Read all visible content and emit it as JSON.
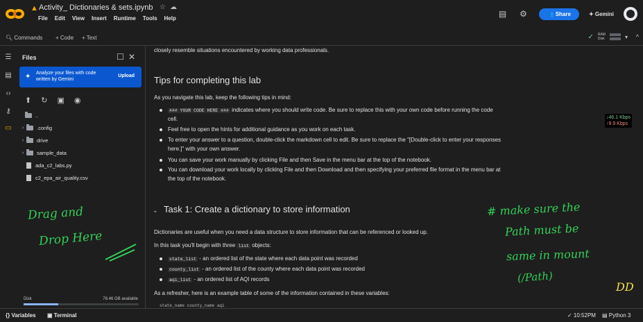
{
  "window": {
    "notebook_title": "Activity_ Dictionaries & sets.ipynb",
    "menu": [
      "File",
      "Edit",
      "View",
      "Insert",
      "Runtime",
      "Tools",
      "Help"
    ],
    "share_label": "Share",
    "gemini_label": "Gemini"
  },
  "toolbar": {
    "commands_label": "Commands",
    "code_label": "+ Code",
    "text_label": "+ Text",
    "ram_label": "RAM",
    "disk_label": "Disk"
  },
  "files_panel": {
    "title": "Files",
    "gemini_card_text": "Analyze your files with code written by Gemini",
    "upload_label": "Upload",
    "tree": [
      {
        "name": "..",
        "kind": "folder",
        "expandable": false
      },
      {
        "name": ".config",
        "kind": "folder",
        "expandable": true
      },
      {
        "name": "drive",
        "kind": "folder",
        "expandable": true
      },
      {
        "name": "sample_data",
        "kind": "folder",
        "expandable": true
      },
      {
        "name": "ada_c2_labs.py",
        "kind": "file",
        "expandable": false
      },
      {
        "name": "c2_epa_air_quality.csv",
        "kind": "file",
        "expandable": false
      }
    ],
    "disk_label": "Disk",
    "disk_available": "78.46 GB available",
    "disk_used_fraction": 0.3
  },
  "content": {
    "intro_line": "closely resemble situations encountered by working data professionals.",
    "tips_heading": "Tips for completing this lab",
    "tips_intro": "As you navigate this lab, keep the following tips in mind:",
    "tip1_code": "### YOUR CODE HERE ###",
    "tip1_text": "indicates where you should write code. Be sure to replace this with your own code before running the code",
    "tip1_text_cont": "cell.",
    "tip2": "Feel free to open the hints for additional guidance as you work on each task.",
    "tip3": "To enter your answer to a question, double-click the markdown cell to edit. Be sure to replace the \"[Double-click to enter your responses",
    "tip3_cont": "here.]\" with your own answer.",
    "tip4": "You can save your work manually by clicking File and then Save in the menu bar at the top of the notebook.",
    "tip5": "You can download your work locally by clicking File and then Download and then specifying your preferred file format in the menu bar at",
    "tip5_cont": "the top of the notebook.",
    "task_heading": "Task 1: Create a dictionary to store information",
    "task_p1": "Dictionaries are useful when you need a data structure to store information that can be referenced or looked up.",
    "task_p2_pre": "In this task you'll begin with three",
    "task_p2_code": "list",
    "task_p2_post": "objects:",
    "list_items": [
      {
        "code": "state_list",
        "text": "- an ordered list of the state where each data point was recorded"
      },
      {
        "code": "county_list",
        "text": "- an ordered list of the county where each data point was recorded"
      },
      {
        "code": "aqi_list",
        "text": "- an ordered list of AQI records"
      }
    ],
    "refresher": "As a refresher, here is an example table of some of the information contained in these variables:",
    "table_header_partial": "state_name    county_name    aqi"
  },
  "annotations": {
    "drag_drop_line1": "Drag and",
    "drag_drop_line2": "Drop Here",
    "note_line1": "# make sure the",
    "note_line2": "Path must be",
    "note_line3": "same in mount",
    "note_line4": "(/Path)",
    "initials": "DD"
  },
  "network": {
    "down": "↓46.1 Kbps",
    "up": "↑9.9 Kbps"
  },
  "statusbar": {
    "variables_label": "Variables",
    "terminal_label": "Terminal",
    "time": "✓ 10:52PM",
    "kernel": "Python 3"
  },
  "colors": {
    "accent": "#1a73e8",
    "brand": "#f9ab00",
    "annotation": "#34d058"
  }
}
